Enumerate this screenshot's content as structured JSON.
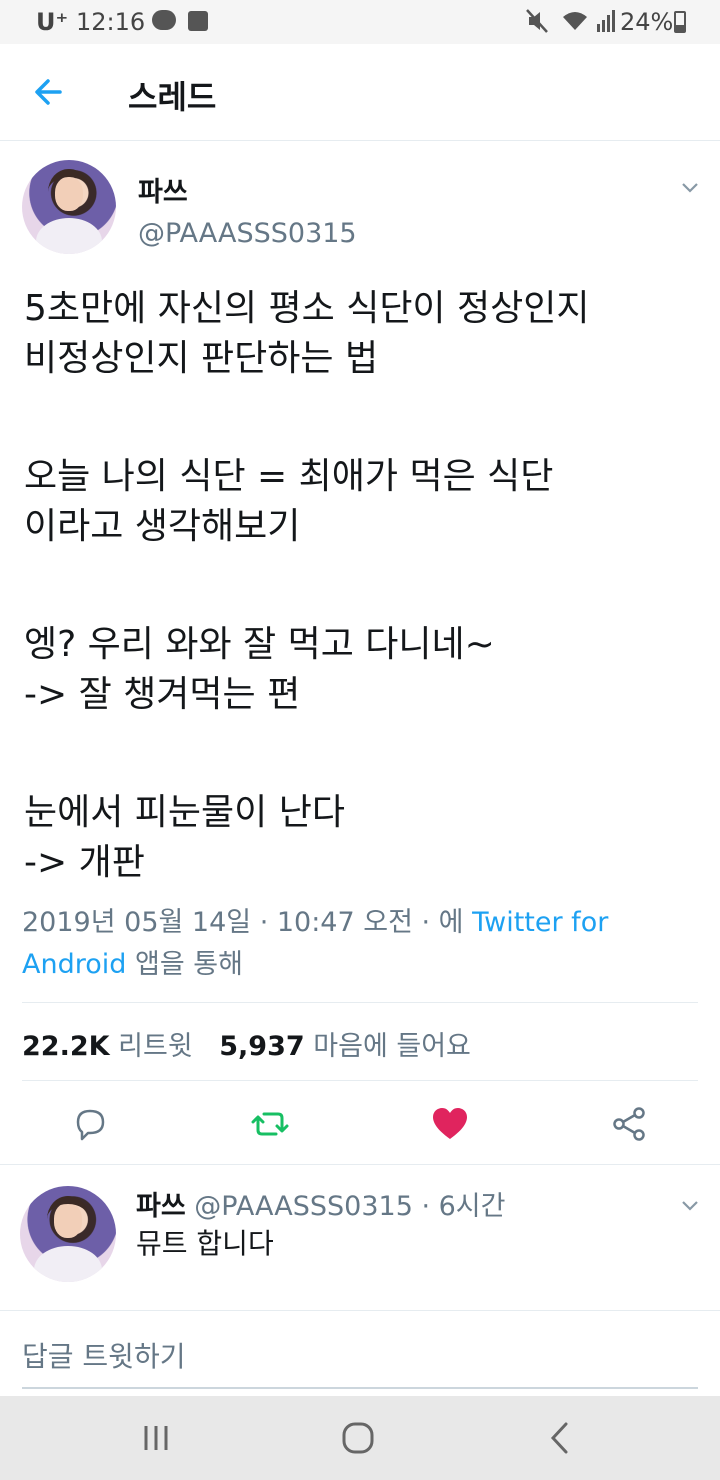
{
  "status_bar": {
    "carrier": "U⁺",
    "time": "12:16",
    "battery": "24%",
    "icons": [
      "kakaotalk-icon",
      "note-icon",
      "mute-icon",
      "wifi-icon",
      "signal-icon",
      "battery-icon"
    ]
  },
  "header": {
    "title": "스레드",
    "back_icon": "arrow-left-icon"
  },
  "tweet": {
    "display_name": "파쓰",
    "handle": "@PAAASSS0315",
    "lines": [
      "5초만에 자신의 평소 식단이 정상인지",
      "비정상인지 판단하는 법",
      "오늘 나의 식단 = 최애가 먹은 식단",
      "이라고 생각해보기",
      "엥? 우리 와와 잘 먹고 다니네~",
      "-> 잘 챙겨먹는 편",
      "눈에서 피눈물이 난다",
      "-> 개판"
    ],
    "date_prefix": "2019년 05월 14일 · 10:47 오전 · 에 ",
    "source_link": "Twitter for Android",
    "source_suffix": " 앱을 통해",
    "retweets": "22.2K",
    "retweets_label": "리트윗",
    "likes": "5,937",
    "likes_label": "마음에 들어요",
    "accent_color": "#1da1f2",
    "retweet_color": "#17bf63",
    "like_color": "#e0245e"
  },
  "reply": {
    "display_name": "파쓰",
    "meta": "@PAAASSS0315 · 6시간",
    "text": "뮤트 합니다"
  },
  "compose": {
    "placeholder": "답글 트윗하기"
  }
}
